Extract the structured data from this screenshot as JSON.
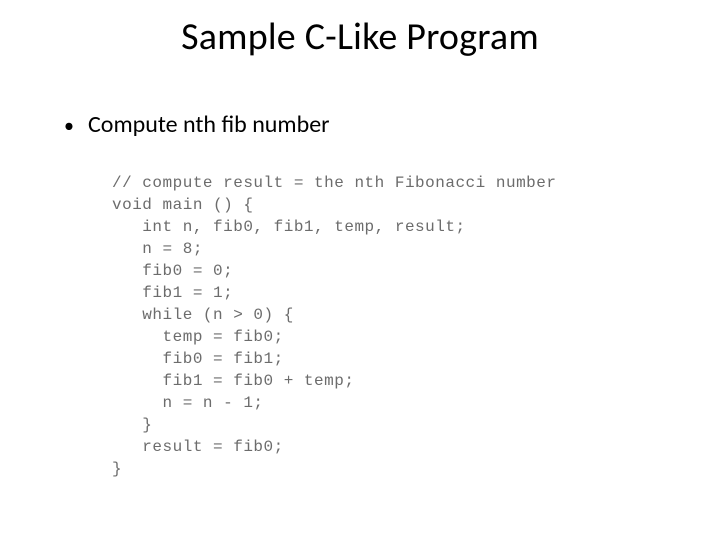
{
  "title": "Sample C-Like Program",
  "bullet": {
    "dot": "•",
    "text": "Compute nth fib number"
  },
  "code": "// compute result = the nth Fibonacci number\nvoid main () {\n   int n, fib0, fib1, temp, result;\n   n = 8;\n   fib0 = 0;\n   fib1 = 1;\n   while (n > 0) {\n     temp = fib0;\n     fib0 = fib1;\n     fib1 = fib0 + temp;\n     n = n - 1;\n   }\n   result = fib0;\n}"
}
